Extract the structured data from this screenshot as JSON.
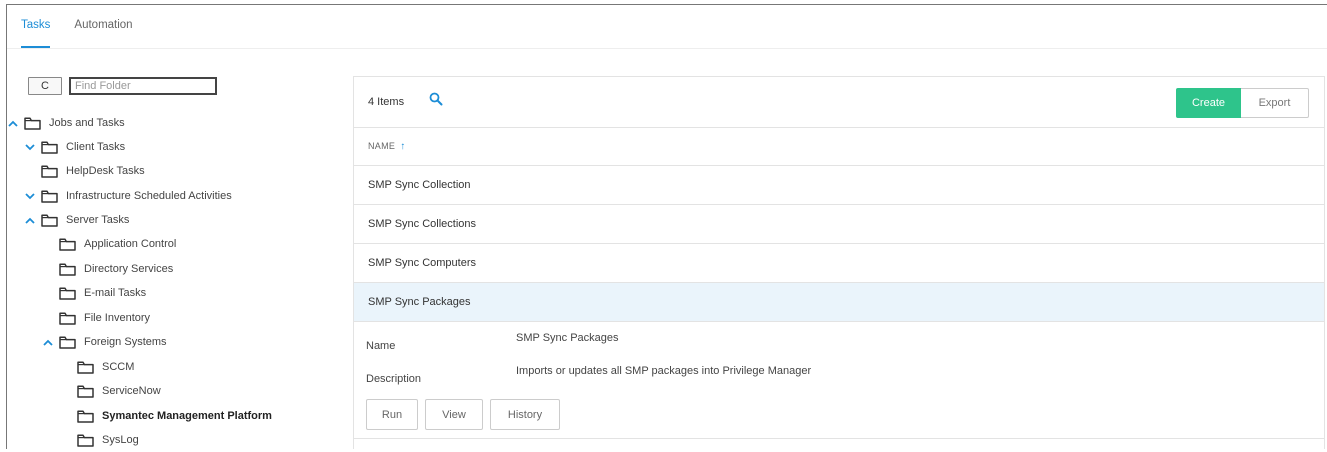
{
  "tabs": [
    {
      "label": "Tasks",
      "active": true
    },
    {
      "label": "Automation",
      "active": false
    }
  ],
  "tree_toolbar": {
    "refresh_glyph": "C",
    "find_placeholder": "Find Folder"
  },
  "tree": [
    {
      "label": "Jobs and Tasks",
      "chevron": "up",
      "bold": false
    },
    {
      "label": "Client Tasks",
      "chevron": "down",
      "bold": false
    },
    {
      "label": "HelpDesk Tasks",
      "chevron": "none",
      "bold": false
    },
    {
      "label": "Infrastructure Scheduled Activities",
      "chevron": "down",
      "bold": false
    },
    {
      "label": "Server Tasks",
      "chevron": "up",
      "bold": false
    },
    {
      "label": "Application Control",
      "chevron": "none",
      "bold": false
    },
    {
      "label": "Directory Services",
      "chevron": "none",
      "bold": false
    },
    {
      "label": "E-mail Tasks",
      "chevron": "none",
      "bold": false
    },
    {
      "label": "File Inventory",
      "chevron": "none",
      "bold": false
    },
    {
      "label": "Foreign Systems",
      "chevron": "up",
      "bold": false
    },
    {
      "label": "SCCM",
      "chevron": "none",
      "bold": false
    },
    {
      "label": "ServiceNow",
      "chevron": "none",
      "bold": false
    },
    {
      "label": "Symantec Management Platform",
      "chevron": "none",
      "bold": true
    },
    {
      "label": "SysLog",
      "chevron": "none",
      "bold": false
    }
  ],
  "list": {
    "count_label": "4 Items",
    "search_icon": "search-icon",
    "create_label": "Create",
    "export_label": "Export",
    "column_header": "NAME",
    "sort_arrow": "↑",
    "rows": [
      {
        "name": "SMP Sync Collection",
        "selected": false
      },
      {
        "name": "SMP Sync Collections",
        "selected": false
      },
      {
        "name": "SMP Sync Computers",
        "selected": false
      },
      {
        "name": "SMP Sync Packages",
        "selected": true
      }
    ]
  },
  "detail": {
    "name_label": "Name",
    "name_value": "SMP Sync Packages",
    "description_label": "Description",
    "description_value": "Imports or updates all SMP packages into Privilege Manager",
    "run_label": "Run",
    "view_label": "View",
    "history_label": "History"
  },
  "colors": {
    "accent": "#1d8dd6",
    "create": "#2ec48b",
    "selected_row": "#eaf4fb"
  }
}
